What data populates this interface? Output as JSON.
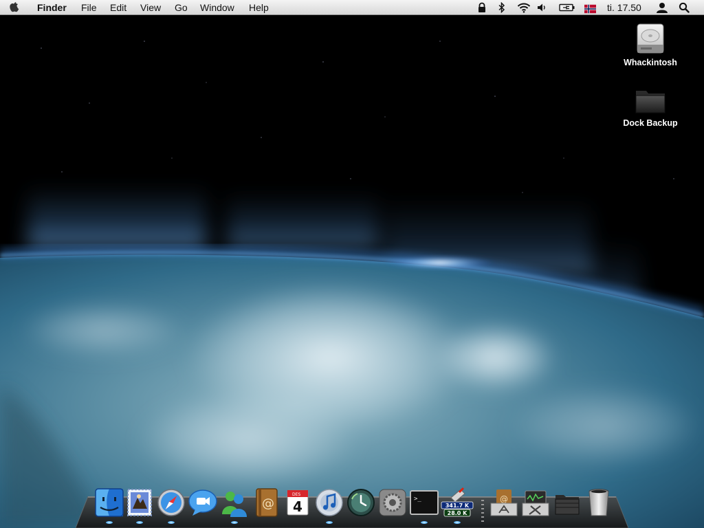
{
  "menubar": {
    "app_name": "Finder",
    "menus": [
      "File",
      "Edit",
      "View",
      "Go",
      "Window",
      "Help"
    ],
    "clock": "ti. 17.50",
    "status_icons": [
      "lock-icon",
      "bluetooth-icon",
      "wifi-icon",
      "volume-icon",
      "battery-icon",
      "norway-flag-icon",
      "user-icon",
      "spotlight-search-icon"
    ]
  },
  "desktop": {
    "icons": [
      {
        "label": "Whackintosh",
        "icon": "hard-drive-icon"
      },
      {
        "label": "Dock Backup",
        "icon": "folder-icon"
      }
    ]
  },
  "dock": {
    "apps": [
      {
        "name": "Finder",
        "icon": "finder-icon",
        "running": true
      },
      {
        "name": "Mail",
        "icon": "mail-icon",
        "running": true
      },
      {
        "name": "Safari",
        "icon": "safari-icon",
        "running": true
      },
      {
        "name": "iChat",
        "icon": "ichat-icon",
        "running": false
      },
      {
        "name": "Messenger",
        "icon": "messenger-icon",
        "running": true
      },
      {
        "name": "Address Book",
        "icon": "address-book-icon",
        "running": false
      },
      {
        "name": "iCal",
        "icon": "ical-icon",
        "running": false
      },
      {
        "name": "iTunes",
        "icon": "itunes-icon",
        "running": true
      },
      {
        "name": "Time Machine",
        "icon": "time-machine-icon",
        "running": false
      },
      {
        "name": "System Preferences",
        "icon": "system-preferences-icon",
        "running": false
      },
      {
        "name": "Terminal",
        "icon": "terminal-icon",
        "running": true
      },
      {
        "name": "Network Monitor",
        "icon": "network-monitor-icon",
        "running": true
      },
      {
        "name": "Applications",
        "icon": "applications-stack-icon",
        "running": false
      },
      {
        "name": "Utilities",
        "icon": "utilities-stack-icon",
        "running": false
      },
      {
        "name": "Documents",
        "icon": "documents-stack-icon",
        "running": false
      },
      {
        "name": "Trash",
        "icon": "trash-icon",
        "running": false
      }
    ],
    "calendar": {
      "month": "DES",
      "day": "4"
    },
    "netmon": {
      "upload": "341.7 K",
      "download": "28.0 K"
    },
    "terminal_prompt": ">_"
  }
}
